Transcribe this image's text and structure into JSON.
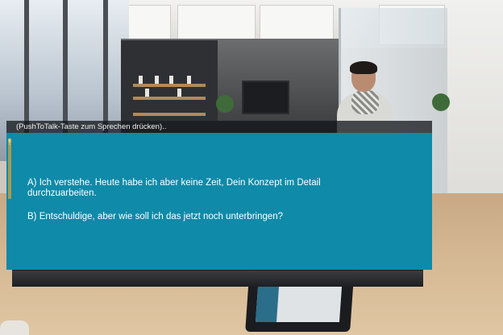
{
  "hud": {
    "hint": "(PushToTalk-Taste zum Sprechen drücken)..",
    "accent_color": "#0f8aa8",
    "mic_icon": "microphone-level-icon"
  },
  "dialogue": {
    "options": [
      {
        "text": "A) Ich verstehe. Heute habe ich aber keine Zeit, Dein Konzept im Detail durchzuarbeiten."
      },
      {
        "text": "B) Entschuldige, aber wie soll ich das jetzt noch unterbringen?"
      }
    ]
  }
}
